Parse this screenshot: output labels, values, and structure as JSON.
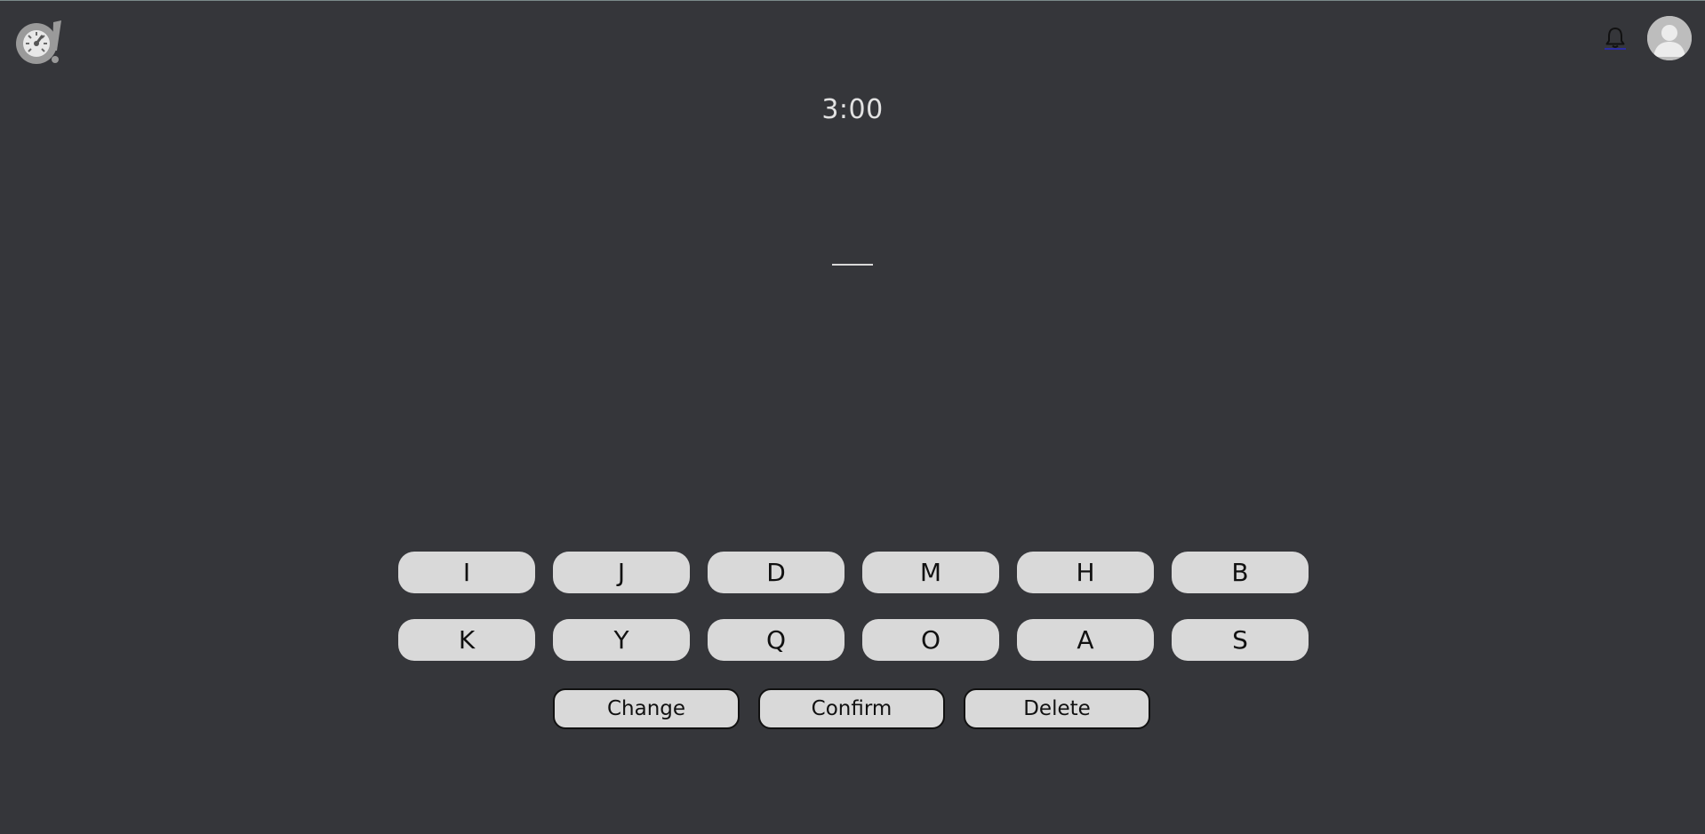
{
  "header": {
    "logo_icon": "speedometer-logo-icon",
    "bell_icon": "bell-icon",
    "avatar_icon": "user-avatar-icon"
  },
  "game": {
    "timer": "3:00",
    "letters": [
      "I",
      "J",
      "D",
      "M",
      "H",
      "B",
      "K",
      "Y",
      "Q",
      "O",
      "A",
      "S"
    ],
    "actions": {
      "change_label": "Change",
      "confirm_label": "Confirm",
      "delete_label": "Delete"
    }
  },
  "colors": {
    "background": "#35363a",
    "button": "#d9d9d9",
    "timer_text": "#e2e2e2"
  }
}
